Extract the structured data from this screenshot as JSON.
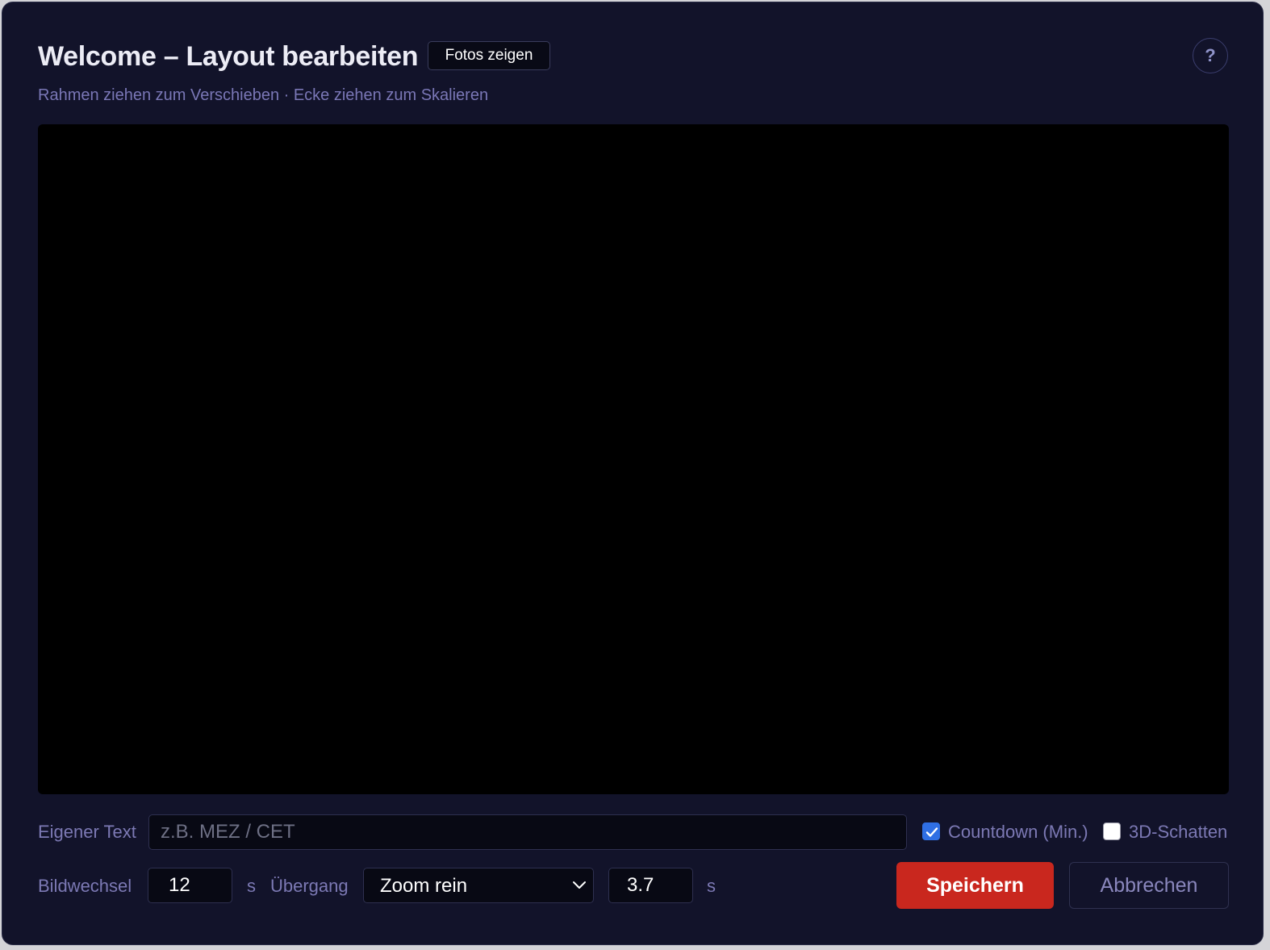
{
  "header": {
    "title": "Welcome – Layout bearbeiten",
    "photos_button": "Fotos zeigen",
    "help_button": "?",
    "subtitle": "Rahmen ziehen zum Verschieben · Ecke ziehen zum Skalieren"
  },
  "custom_text": {
    "label": "Eigener Text",
    "value": "",
    "placeholder": "z.B. MEZ / CET"
  },
  "countdown": {
    "label": "Countdown (Min.)",
    "checked": true
  },
  "shadow3d": {
    "label": "3D-Schatten",
    "checked": false
  },
  "image_change": {
    "label": "Bildwechsel",
    "value": "12",
    "unit": "s"
  },
  "transition": {
    "label": "Übergang",
    "selected": "Zoom rein",
    "duration": "3.7",
    "unit": "s"
  },
  "actions": {
    "save_label": "Speichern",
    "cancel_label": "Abbrechen"
  },
  "colors": {
    "accent_save": "#c9271e",
    "checkbox_on": "#2f6fe4",
    "background": "#12132a"
  }
}
